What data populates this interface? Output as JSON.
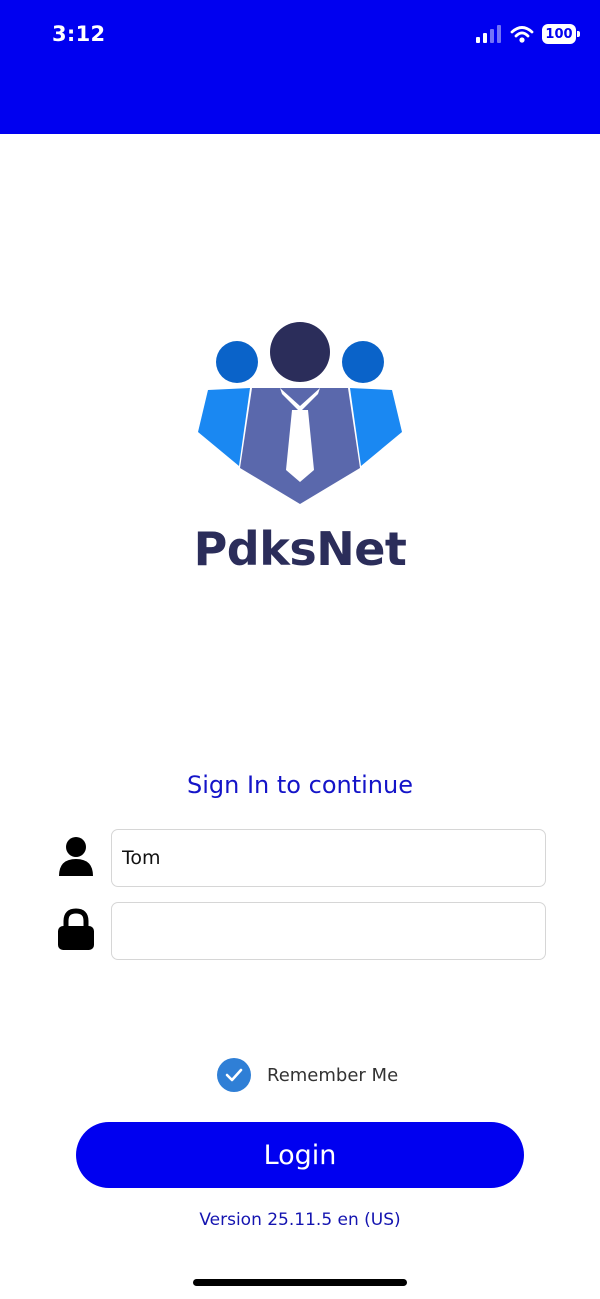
{
  "status_bar": {
    "time": "3:12",
    "battery": "100"
  },
  "app": {
    "name": "PdksNet"
  },
  "login_form": {
    "title": "Sign In to continue",
    "username_value": "Tom",
    "password_value": "",
    "remember_label": "Remember Me",
    "remember_checked": true,
    "login_label": "Login"
  },
  "footer": {
    "version": "Version 25.11.5 en (US)"
  },
  "colors": {
    "primary": "#0000F0",
    "brand_text": "#2B2D5A",
    "logo_light_blue": "#1A88F2",
    "logo_mid_blue": "#5A68AC",
    "checkbox": "#2F7FD6"
  }
}
